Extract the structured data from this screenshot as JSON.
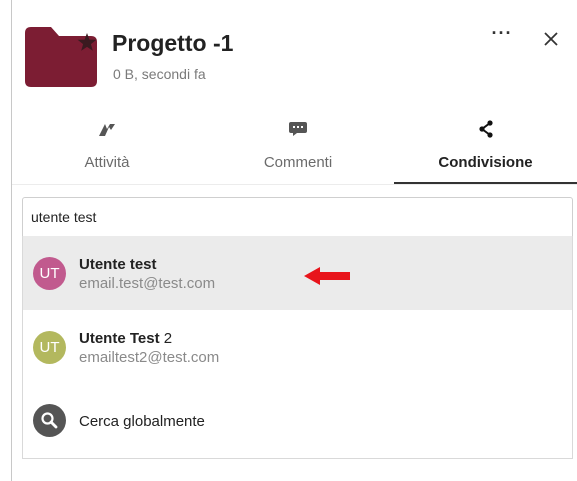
{
  "header": {
    "title": "Progetto -1",
    "subtitle": "0 B, secondi fa",
    "folder_icon": "folder-icon",
    "favorite_icon": "star-icon",
    "more_label": "···",
    "colors": {
      "folder": "#7c1d33",
      "star": "#3a1a20"
    }
  },
  "tabs": [
    {
      "label": "Attività",
      "icon": "activity-icon",
      "active": false
    },
    {
      "label": "Commenti",
      "icon": "comment-icon",
      "active": false
    },
    {
      "label": "Condivisione",
      "icon": "share-icon",
      "active": true
    }
  ],
  "search": {
    "value": "utente test"
  },
  "results": [
    {
      "initials": "UT",
      "name": "Utente test",
      "name_suffix": "",
      "email": "email.test@test.com",
      "avatar_color": "#c15a8e",
      "highlighted": true
    },
    {
      "initials": "UT",
      "name": "Utente Test",
      "name_suffix": " 2",
      "email": "emailtest2@test.com",
      "avatar_color": "#b3b85e",
      "highlighted": false
    }
  ],
  "global_search": {
    "label": "Cerca globalmente",
    "icon": "search-icon"
  },
  "annotation": {
    "icon": "red-arrow-icon",
    "color": "#e8141b"
  }
}
